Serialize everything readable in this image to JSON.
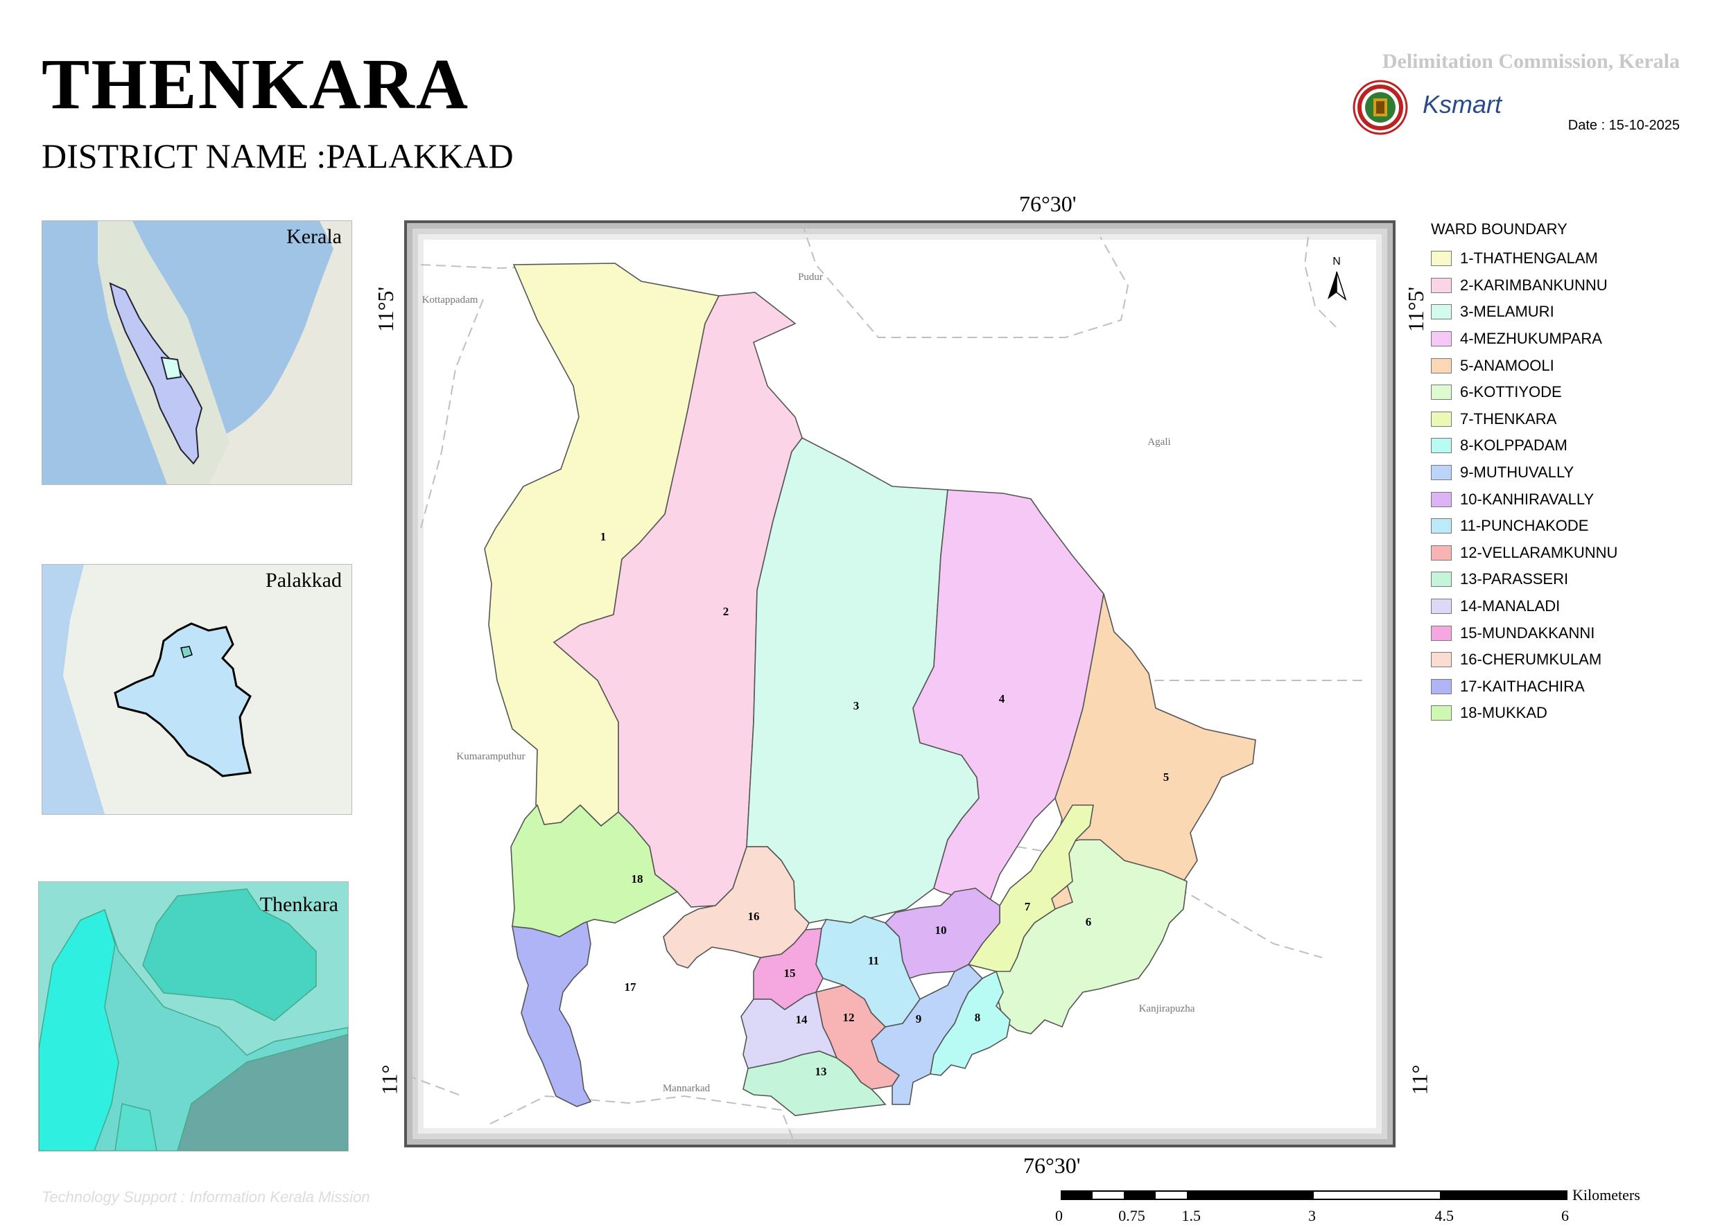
{
  "title": "THENKARA",
  "district_label": "DISTRICT NAME :PALAKKAD",
  "commission": "Delimitation Commission, Kerala",
  "date": "Date : 15-10-2025",
  "ksmart_logo": "Ksmart",
  "insets": {
    "kerala": "Kerala",
    "palakkad": "Palakkad",
    "thenkara": "Thenkara"
  },
  "coords": {
    "top": "76°30'",
    "bottom": "76°30'",
    "left_top": "11°5'",
    "left_bottom": "11°",
    "right_top": "11°5'",
    "right_bottom": "11°"
  },
  "places": {
    "kottappadam": "Kottappadam",
    "pudur": "Pudur",
    "agali": "Agali",
    "kumaramputhur": "Kumaramputhur",
    "kanjirapuzha": "Kanjirapuzha",
    "mannarkad": "Mannarkad"
  },
  "north": "N",
  "legend": {
    "title": "WARD BOUNDARY",
    "items": [
      {
        "label": "1-THATHENGALAM",
        "color": "#fafac8"
      },
      {
        "label": "2-KARIMBANKUNNU",
        "color": "#fcd4e8"
      },
      {
        "label": "3-MELAMURI",
        "color": "#d4faee"
      },
      {
        "label": "4-MEZHUKUMPARA",
        "color": "#f5c8f5"
      },
      {
        "label": "5-ANAMOOLI",
        "color": "#fad8b4"
      },
      {
        "label": "6-KOTTIYODE",
        "color": "#defad0"
      },
      {
        "label": "7-THENKARA",
        "color": "#eafab4"
      },
      {
        "label": "8-KOLPPADAM",
        "color": "#b8faf4"
      },
      {
        "label": "9-MUTHUVALLY",
        "color": "#bcd4fa"
      },
      {
        "label": "10-KANHIRAVALLY",
        "color": "#dcb4f5"
      },
      {
        "label": "11-PUNCHAKODE",
        "color": "#bceaf8"
      },
      {
        "label": "12-VELLARAMKUNNU",
        "color": "#f8b4b4"
      },
      {
        "label": "13-PARASSERI",
        "color": "#c4f5da"
      },
      {
        "label": "14-MANALADI",
        "color": "#dcd8f8"
      },
      {
        "label": "15-MUNDAKKANNI",
        "color": "#f5a8e0"
      },
      {
        "label": "16-CHERUMKULAM",
        "color": "#fadcd0"
      },
      {
        "label": "17-KAITHACHIRA",
        "color": "#aeb4f5"
      },
      {
        "label": "18-MUKKAD",
        "color": "#ccf8b0"
      }
    ]
  },
  "scale": {
    "unit": "Kilometers",
    "ticks": [
      "0",
      "0.75",
      "1.5",
      "3",
      "4.5",
      "6"
    ]
  },
  "footer": "Technology Support : Information Kerala Mission"
}
